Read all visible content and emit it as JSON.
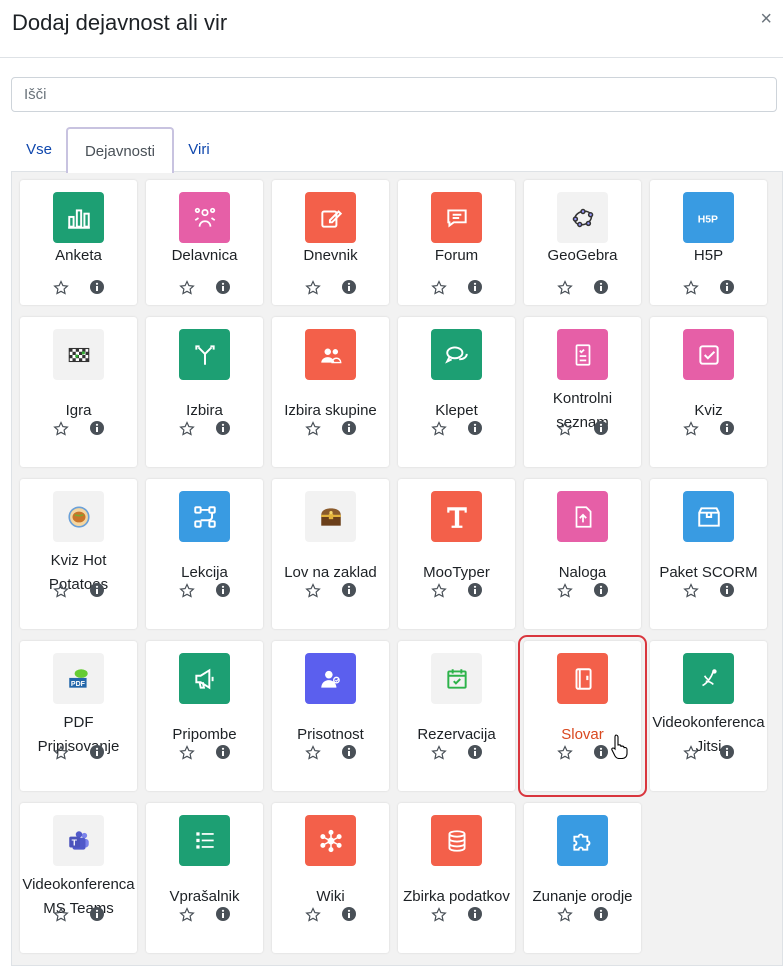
{
  "dialog": {
    "title": "Dodaj dejavnost ali vir",
    "close_glyph": "×"
  },
  "search": {
    "placeholder": "Išči"
  },
  "tabs": [
    "Vse",
    "Dejavnosti",
    "Viri"
  ],
  "active_tab": "Dejavnosti",
  "modules": [
    {
      "name": "Anketa",
      "color": "#1d9f73",
      "icon": "bar-chart-icon"
    },
    {
      "name": "Delavnica",
      "color": "#e65fa7",
      "icon": "workshop-icon"
    },
    {
      "name": "Dnevnik",
      "color": "#f3604a",
      "icon": "journal-icon"
    },
    {
      "name": "Forum",
      "color": "#f3604a",
      "icon": "forum-icon"
    },
    {
      "name": "GeoGebra",
      "color": "#f2f2f2",
      "icon": "geogebra-icon"
    },
    {
      "name": "H5P",
      "color": "#399be2",
      "icon": "h5p-icon"
    },
    {
      "name": "Igra",
      "color": "#f2f2f2",
      "icon": "game-icon"
    },
    {
      "name": "Izbira",
      "color": "#1d9f73",
      "icon": "choice-icon"
    },
    {
      "name": "Izbira skupine",
      "color": "#f3604a",
      "icon": "group-choice-icon"
    },
    {
      "name": "Klepet",
      "color": "#1d9f73",
      "icon": "chat-icon"
    },
    {
      "name": "Kontrolni seznam",
      "color": "#e65fa7",
      "icon": "checklist-icon"
    },
    {
      "name": "Kviz",
      "color": "#e65fa7",
      "icon": "quiz-icon"
    },
    {
      "name": "Kviz Hot Potatoes",
      "color": "#f2f2f2",
      "icon": "hot-potatoes-icon"
    },
    {
      "name": "Lekcija",
      "color": "#399be2",
      "icon": "lesson-icon"
    },
    {
      "name": "Lov na zaklad",
      "color": "#f2f2f2",
      "icon": "treasure-chest-icon"
    },
    {
      "name": "MooTyper",
      "color": "#f3604a",
      "icon": "mootyper-icon"
    },
    {
      "name": "Naloga",
      "color": "#e65fa7",
      "icon": "assignment-icon"
    },
    {
      "name": "Paket SCORM",
      "color": "#399be2",
      "icon": "scorm-package-icon"
    },
    {
      "name": "PDF Pripisovanje",
      "color": "#f2f2f2",
      "icon": "pdf-annotation-icon"
    },
    {
      "name": "Pripombe",
      "color": "#1d9f73",
      "icon": "feedback-megaphone-icon"
    },
    {
      "name": "Prisotnost",
      "color": "#5b5fee",
      "icon": "attendance-icon"
    },
    {
      "name": "Rezervacija",
      "color": "#f2f2f2",
      "icon": "reservation-calendar-icon"
    },
    {
      "name": "Slovar",
      "color": "#f3604a",
      "icon": "glossary-book-icon"
    },
    {
      "name": "Videokonferenca Jitsi",
      "color": "#1d9f73",
      "icon": "jitsi-icon"
    },
    {
      "name": "Videokonferenca MS Teams",
      "color": "#f2f2f2",
      "icon": "ms-teams-icon"
    },
    {
      "name": "Vprašalnik",
      "color": "#1d9f73",
      "icon": "questionnaire-icon"
    },
    {
      "name": "Wiki",
      "color": "#f3604a",
      "icon": "wiki-icon"
    },
    {
      "name": "Zbirka podatkov",
      "color": "#f3604a",
      "icon": "database-icon"
    },
    {
      "name": "Zunanje orodje",
      "color": "#399be2",
      "icon": "puzzle-icon"
    }
  ],
  "highlighted_module": "Slovar",
  "colors": {
    "link": "#0f47ad",
    "highlight_border": "#d9363e",
    "highlight_text": "#d9481f"
  }
}
